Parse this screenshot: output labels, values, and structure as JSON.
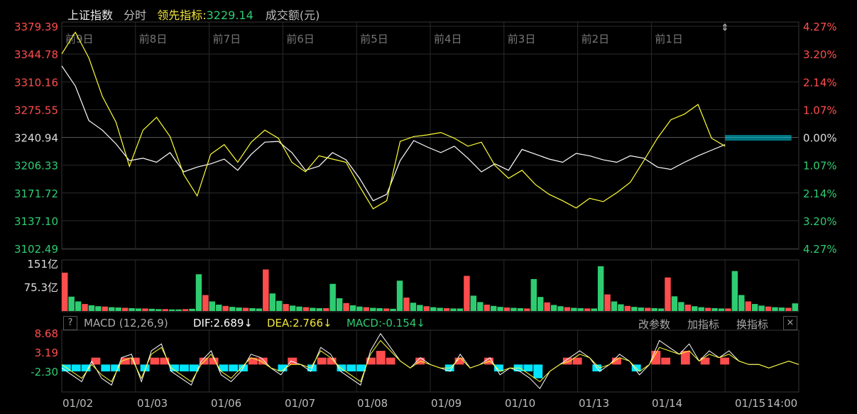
{
  "header": {
    "index_name": "上证指数",
    "mode": "分时",
    "leading_label": "领先指标:",
    "leading_value": "3229.14",
    "volume_label": "成交额(元)"
  },
  "macd_bar": {
    "help": "?",
    "title": "MACD (12,26,9)",
    "dif": "DIF:2.689↓",
    "dea": "DEA:2.766↓",
    "macd": "MACD:-0.154↓",
    "btn_edit": "改参数",
    "btn_add": "加指标",
    "btn_switch": "换指标",
    "close": "×"
  },
  "colors": {
    "bg": "#000000",
    "grid": "#2a2a2a",
    "up": "#ff4d4d",
    "down": "#2ecc71",
    "white_line": "#ffffff",
    "yellow_line": "#ffff33",
    "cyan": "#00e5ff",
    "leading_yellow": "#f2e63d"
  },
  "chart_data": [
    {
      "type": "line",
      "name": "price",
      "day_labels": [
        "前9日",
        "前8日",
        "前7日",
        "前6日",
        "前5日",
        "前4日",
        "前3日",
        "前2日",
        "前1日",
        ""
      ],
      "y_left_labels": [
        "3379.39",
        "3344.78",
        "3310.16",
        "3275.55",
        "3240.94",
        "3206.33",
        "3171.72",
        "3137.10",
        "3102.49"
      ],
      "y_right_labels": [
        "4.27%",
        "3.20%",
        "2.14%",
        "1.07%",
        "0.00%",
        "1.07%",
        "2.14%",
        "3.20%",
        "4.27%"
      ],
      "ylim": [
        3102.49,
        3379.39
      ],
      "base": 3240.94,
      "series": [
        {
          "values": [
            3330,
            3305,
            3262,
            3250,
            3233,
            3212,
            3215,
            3210,
            3222,
            3198,
            3204,
            3208,
            3214,
            3200,
            3220,
            3235,
            3236,
            3222,
            3200,
            3205,
            3222,
            3213,
            3190,
            3162,
            3170,
            3212,
            3237,
            3229,
            3222,
            3230,
            3215,
            3198,
            3208,
            3200,
            3226,
            3220,
            3214,
            3210,
            3221,
            3218,
            3213,
            3210,
            3218,
            3215,
            3204,
            3201,
            3210,
            3218,
            3225,
            3232
          ]
        },
        {
          "values": [
            3345,
            3372,
            3340,
            3292,
            3260,
            3205,
            3250,
            3266,
            3242,
            3195,
            3168,
            3220,
            3232,
            3210,
            3235,
            3250,
            3240,
            3210,
            3198,
            3218,
            3214,
            3210,
            3180,
            3152,
            3162,
            3236,
            3242,
            3244,
            3247,
            3240,
            3230,
            3235,
            3206,
            3190,
            3200,
            3182,
            3170,
            3162,
            3153,
            3165,
            3161,
            3172,
            3185,
            3212,
            3240,
            3263,
            3270,
            3282,
            3240,
            3230
          ]
        }
      ]
    },
    {
      "type": "bar",
      "name": "volume",
      "y_labels": [
        "151亿",
        "75.3亿"
      ],
      "ylim": [
        0,
        151
      ],
      "values": [
        120,
        45,
        30,
        22,
        18,
        15,
        14,
        12,
        11,
        10,
        9,
        8,
        8,
        7,
        6,
        6,
        5,
        5,
        6,
        7,
        115,
        50,
        30,
        20,
        16,
        13,
        11,
        10,
        9,
        8,
        130,
        55,
        32,
        22,
        17,
        14,
        12,
        10,
        9,
        9,
        85,
        40,
        25,
        18,
        14,
        12,
        10,
        9,
        8,
        7,
        95,
        42,
        26,
        19,
        15,
        12,
        10,
        9,
        8,
        8,
        110,
        48,
        28,
        20,
        16,
        13,
        11,
        10,
        9,
        8,
        100,
        44,
        27,
        19,
        15,
        12,
        10,
        9,
        8,
        8,
        140,
        52,
        30,
        21,
        16,
        13,
        11,
        10,
        9,
        8,
        105,
        46,
        28,
        20,
        15,
        12,
        10,
        9,
        8,
        8,
        125,
        50,
        30,
        22,
        17,
        14,
        12,
        11,
        10,
        24
      ]
    },
    {
      "type": "line",
      "name": "macd",
      "y_labels": [
        "8.68",
        "3.19",
        "-2.30"
      ],
      "ylim": [
        -8,
        10
      ],
      "x_labels": [
        "01/02",
        "01/03",
        "01/06",
        "01/07",
        "01/08",
        "01/09",
        "01/10",
        "01/13",
        "01/14",
        "01/15",
        "14:00"
      ],
      "dif": [
        -1,
        -3,
        -5,
        1,
        -4,
        -6,
        2,
        3,
        -5,
        4,
        6,
        -2,
        -4,
        -6,
        1,
        4,
        -3,
        -5,
        -2,
        3,
        2,
        -1,
        -3,
        1,
        0,
        -2,
        5,
        3,
        -2,
        -4,
        -6,
        4,
        9,
        5,
        1,
        -1,
        2,
        0,
        -1,
        -2,
        3,
        -1,
        0,
        2,
        -3,
        -1,
        -2,
        -4,
        -7,
        -2,
        0,
        2,
        4,
        2,
        -2,
        0,
        3,
        1,
        -3,
        0,
        7,
        5,
        3,
        6,
        1,
        4,
        2,
        4,
        1,
        0,
        0,
        -1,
        0,
        1,
        0
      ],
      "dea": [
        0,
        -2,
        -4,
        0,
        -3,
        -5,
        1,
        2,
        -4,
        3,
        5,
        -1,
        -3,
        -5,
        0,
        3,
        -2,
        -4,
        -1,
        2,
        1,
        -1,
        -2,
        0,
        0,
        -1,
        4,
        2,
        -1,
        -3,
        -5,
        3,
        7,
        4,
        1,
        -1,
        1,
        0,
        -1,
        -1,
        2,
        -1,
        0,
        1,
        -2,
        -1,
        -1,
        -3,
        -5,
        -2,
        0,
        1,
        3,
        2,
        -1,
        0,
        2,
        1,
        -2,
        0,
        5,
        4,
        3,
        4,
        1,
        3,
        2,
        3,
        1,
        0,
        0,
        -1,
        0,
        1,
        0
      ],
      "hist": [
        -1,
        -1,
        -1,
        1,
        -1,
        -1,
        1,
        1,
        -1,
        1,
        1,
        -1,
        -1,
        -1,
        1,
        1,
        -1,
        -1,
        -1,
        1,
        1,
        0,
        -1,
        1,
        0,
        -1,
        1,
        1,
        -1,
        -1,
        -1,
        1,
        2,
        1,
        0,
        0,
        1,
        0,
        0,
        -1,
        1,
        0,
        0,
        1,
        -1,
        0,
        -1,
        -1,
        -2,
        0,
        0,
        1,
        1,
        0,
        -1,
        0,
        1,
        0,
        -1,
        0,
        2,
        1,
        0,
        2,
        0,
        1,
        0,
        1,
        0,
        0,
        0,
        0,
        0,
        0,
        0
      ]
    }
  ]
}
